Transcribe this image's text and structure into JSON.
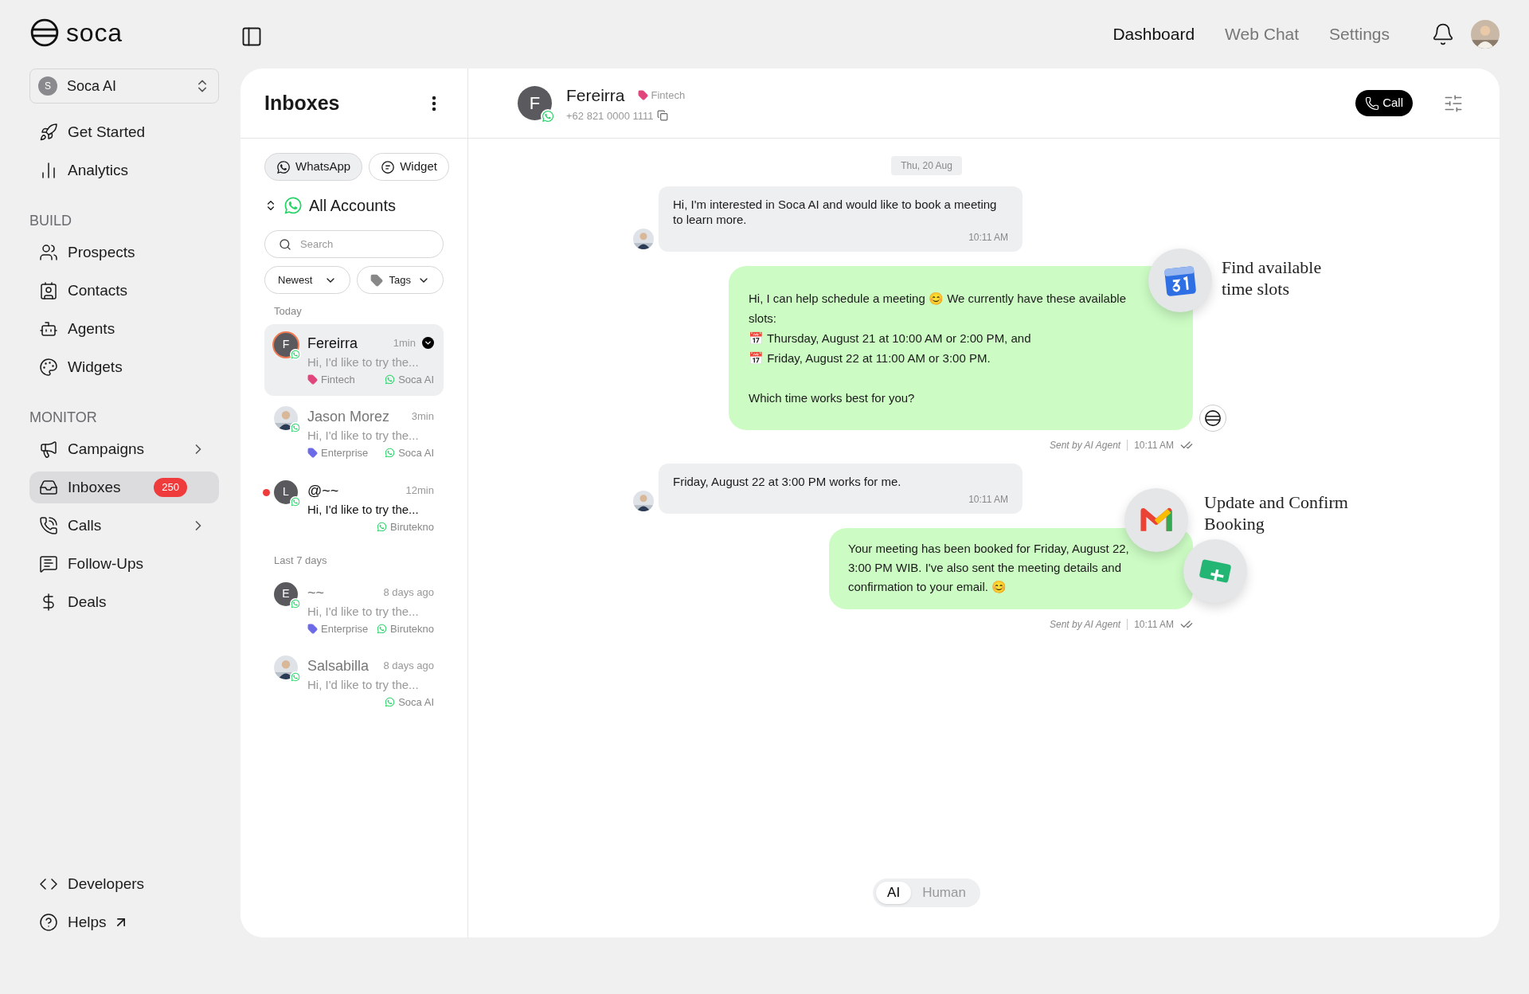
{
  "brand": "soca",
  "workspace": {
    "initial": "S",
    "name": "Soca AI"
  },
  "sidebar": {
    "sections": [
      {
        "items": [
          {
            "label": "Get Started",
            "selected": false
          },
          {
            "label": "Analytics",
            "selected": false
          }
        ]
      },
      {
        "title": "BUILD",
        "items": [
          {
            "label": "Prospects",
            "selected": false
          },
          {
            "label": "Contacts",
            "selected": false
          },
          {
            "label": "Agents",
            "selected": false
          },
          {
            "label": "Widgets",
            "selected": false
          }
        ]
      },
      {
        "title": "MONITOR",
        "items": [
          {
            "label": "Campaigns",
            "selected": false,
            "expandable": true
          },
          {
            "label": "Inboxes",
            "selected": true,
            "badge": "250"
          },
          {
            "label": "Calls",
            "selected": false,
            "expandable": true
          },
          {
            "label": "Follow-Ups",
            "selected": false
          },
          {
            "label": "Deals",
            "selected": false
          }
        ]
      }
    ],
    "footer": [
      {
        "label": "Developers",
        "external": false
      },
      {
        "label": "Helps",
        "external": true
      }
    ]
  },
  "top_nav": [
    {
      "label": "Dashboard",
      "selected": true
    },
    {
      "label": "Web Chat",
      "selected": false
    },
    {
      "label": "Settings",
      "selected": false
    }
  ],
  "inbox": {
    "title": "Inboxes",
    "channels": [
      {
        "label": "WhatsApp",
        "kind": "whatsapp",
        "selected": true
      },
      {
        "label": "Widget",
        "kind": "widget",
        "selected": false
      }
    ],
    "account": "All Accounts",
    "search": {
      "placeholder": "Search"
    },
    "filters": [
      {
        "label": "Newest",
        "kind": "sort"
      },
      {
        "label": "Tags",
        "kind": "tag"
      }
    ],
    "groups": [
      {
        "title": "Today",
        "conversations": [
          {
            "name": "Fereirra",
            "avatar": {
              "kind": "letter",
              "letter": "F"
            },
            "time": "1min",
            "preview": "Hi, I'd like to try the...",
            "tag": {
              "label": "Fintech",
              "color": "#e0457b"
            },
            "account": "Soca AI",
            "selected": true,
            "unread": false
          },
          {
            "name": "Jason Morez",
            "time": "3min",
            "preview": "Hi, I'd like to try the...",
            "tag": {
              "label": "Enterprise",
              "color": "#6d6ae8"
            },
            "account": "Soca AI",
            "selected": false,
            "unread": false
          },
          {
            "name": "@~~",
            "avatar": {
              "kind": "letter",
              "letter": "L"
            },
            "time": "12min",
            "preview": "Hi, I'd like to try the...",
            "account": "Birutekno",
            "selected": false,
            "unread": true
          }
        ]
      },
      {
        "title": "Last 7 days",
        "conversations": [
          {
            "name": "~~",
            "avatar": {
              "kind": "letter",
              "letter": "E"
            },
            "time": "8 days ago",
            "preview": "Hi, I'd like to try the...",
            "tag": {
              "label": "Enterprise",
              "color": "#6d6ae8"
            },
            "account": "Birutekno",
            "selected": false,
            "unread": false
          },
          {
            "name": "Salsabilla",
            "time": "8 days ago",
            "preview": "Hi, I'd like to try the...",
            "account": "Soca AI",
            "selected": false,
            "unread": false
          }
        ]
      }
    ]
  },
  "chat": {
    "contact": {
      "initial": "F",
      "name": "Fereirra",
      "tag": {
        "label": "Fintech",
        "color": "#e0457b"
      },
      "phone": "+62 821 0000 1111"
    },
    "call_button": "Call",
    "date": "Thu, 20 Aug",
    "messages": [
      {
        "kind": "incoming",
        "paragraphs": [
          [
            "Hi, I'm interested in Soca AI and would like to book a meeting to learn more."
          ]
        ],
        "time": "10:11 AM"
      },
      {
        "kind": "outgoing",
        "paragraphs": [
          [
            "Hi, I can help schedule a meeting 😊 We currently have these available slots:",
            "📅 Thursday, August 21 at 10:00 AM or 2:00 PM, and",
            "📅 Friday, August 22 at 11:00 AM or 3:00 PM."
          ],
          [
            "Which time works best for you?"
          ]
        ],
        "sender": "Sent by AI Agent",
        "time": "10:11 AM",
        "annotation": {
          "text": "Find available time slots",
          "kind": "calendar"
        },
        "agent_mark": true
      },
      {
        "kind": "incoming",
        "paragraphs": [
          [
            "Friday, August 22 at 3:00 PM works for me."
          ]
        ],
        "time": "10:11 AM"
      },
      {
        "kind": "outgoing",
        "paragraphs": [
          [
            "Your meeting has been booked for Friday, August 22, 3:00 PM WIB. I've also sent the meeting details and confirmation to your email. 😊"
          ]
        ],
        "sender": "Sent by AI Agent",
        "time": "10:11 AM",
        "annotation": {
          "text": "Update and Confirm Booking",
          "kind": "mail"
        }
      }
    ],
    "mode_toggle": [
      {
        "label": "AI",
        "selected": true
      },
      {
        "label": "Human",
        "selected": false
      }
    ]
  }
}
